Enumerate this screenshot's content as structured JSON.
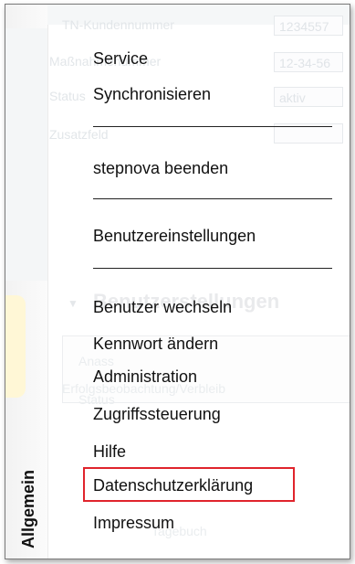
{
  "background": {
    "fields": [
      {
        "label": "TN-Kundennummer",
        "value": "1234557"
      },
      {
        "label": "Maßnahmenummer",
        "value": "12-34-56"
      },
      {
        "label": "Status",
        "value": "aktiv"
      },
      {
        "label": "Zusatzfeld",
        "value": ""
      }
    ],
    "section_title": "Benutzerstellungen",
    "box_title": "Anass",
    "box_line1": "Erfolgsbeobachtung/Verbleib",
    "box_line2": "Status",
    "bottom_text": "Tagebuch"
  },
  "menu": {
    "group1": [
      "Service",
      "Synchronisieren"
    ],
    "group2": [
      "stepnova beenden"
    ],
    "group3": [
      "Benutzereinstellungen"
    ],
    "group4": [
      "Benutzer wechseln",
      "Kennwort ändern",
      "Administration",
      "Zugriffssteuerung",
      "Hilfe",
      "Datenschutzerklärung",
      "Impressum"
    ],
    "highlighted_item": "Datenschutzerklärung",
    "highlight_color": "#e0242c"
  },
  "side_tab": {
    "label": "Allgemein"
  }
}
